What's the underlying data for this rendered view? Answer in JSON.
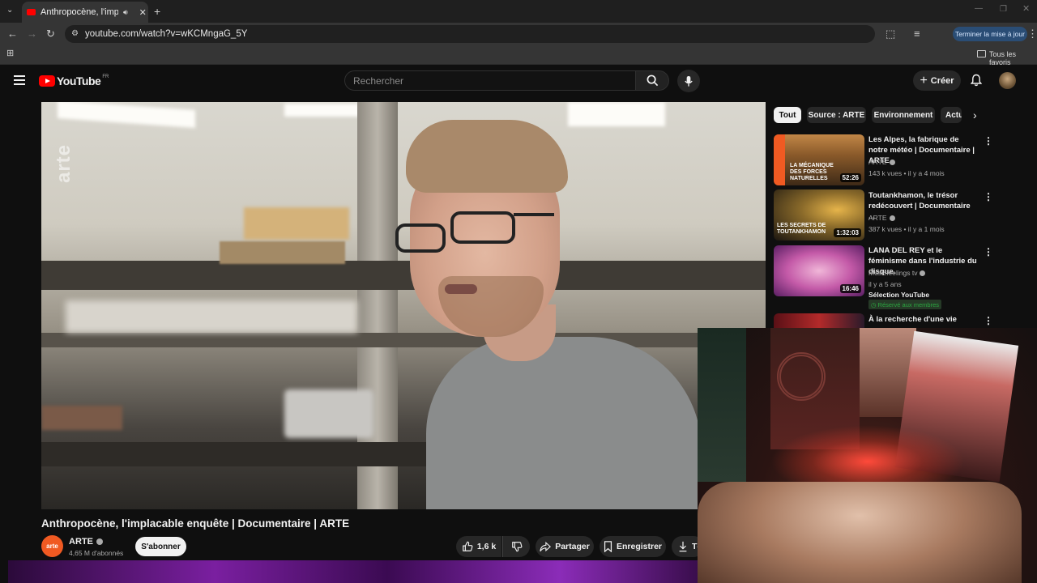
{
  "browser": {
    "tab_title": "Anthropocène, l'implacable",
    "url": "youtube.com/watch?v=wKCMngaG_5Y",
    "update_button": "Terminer la mise à jour",
    "bookmarks_all": "Tous les favoris"
  },
  "youtube": {
    "logo_text": "YouTube",
    "logo_region": "FR",
    "search_placeholder": "Rechercher",
    "create_label": "Créer",
    "video": {
      "watermark": "arte",
      "title": "Anthropocène, l'implacable enquête | Documentaire | ARTE",
      "channel_name": "ARTE",
      "channel_avatar_text": "arte",
      "subscribers": "4,65 M d'abonnés",
      "subscribe_label": "S'abonner",
      "likes": "1,6 k",
      "share_label": "Partager",
      "save_label": "Enregistrer",
      "download_label": "Té"
    },
    "chips": [
      "Tout",
      "Source : ARTE",
      "Environnement",
      "Actu"
    ],
    "recommendations": [
      {
        "title": "Les Alpes, la fabrique de notre météo | Documentaire | ARTE",
        "channel": "ARTE",
        "meta": "143 k vues • il y a 4 mois",
        "duration": "52:26",
        "thumb_text": "LA MÉCANIQUE DES FORCES NATURELLES"
      },
      {
        "title": "Toutankhamon, le trésor redécouvert | Documentaire ...",
        "channel": "ARTE",
        "meta": "387 k vues • il y a 1 mois",
        "duration": "1:32:03",
        "thumb_text": "LES SECRETS DE TOUTANKHAMON"
      },
      {
        "title": "LANA DEL REY et le féminisme dans l'industrie du disque.",
        "channel": "Musicfeelings tv",
        "meta": "il y a 5 ans",
        "extra": "Sélection YouTube",
        "badge": "Réservé aux membres",
        "duration": "16:46"
      },
      {
        "title": "À la recherche d'une vie",
        "channel": "",
        "meta": ""
      }
    ]
  },
  "colors": {
    "yt_red": "#ff0000",
    "bg": "#0f0f0f",
    "chip_bg": "#272727",
    "member_green": "#2ba640",
    "arte_orange": "#f05a22"
  }
}
